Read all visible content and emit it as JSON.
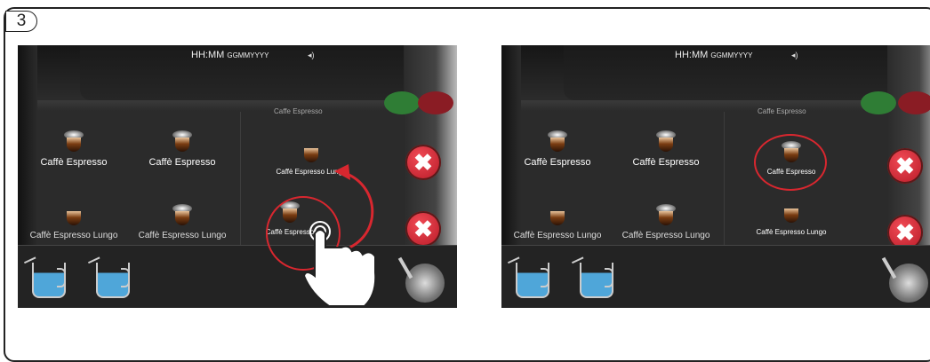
{
  "step": {
    "number": "3"
  },
  "screen_left": {
    "status": {
      "time": "HH:MM",
      "date": "GGMMYYYY"
    },
    "peek_label": "Caffe Espresso",
    "items": [
      {
        "label": "Caffè Espresso"
      },
      {
        "label": "Caffè Espresso"
      },
      {
        "label": "Caffè Espresso Lungo"
      },
      {
        "label": "Caffè Espresso Lungo"
      },
      {
        "label": "Caffè Espresso Lungo"
      },
      {
        "label": "Caffè Espresso"
      }
    ]
  },
  "screen_right": {
    "status": {
      "time": "HH:MM",
      "date": "GGMMYYYY"
    },
    "peek_label": "Caffe Espresso",
    "items": [
      {
        "label": "Caffè Espresso"
      },
      {
        "label": "Caffè Espresso"
      },
      {
        "label": "Caffè Espresso"
      },
      {
        "label": "Caffè Espresso Lungo"
      },
      {
        "label": "Caffè Espresso Lungo"
      },
      {
        "label": "Caffè Espresso Lungo"
      }
    ]
  },
  "icons": {
    "close": "✖",
    "volume": "◂)"
  },
  "colors": {
    "highlight": "#d8272f",
    "delete": "#d8272f",
    "milk": "#4fa6d9"
  }
}
